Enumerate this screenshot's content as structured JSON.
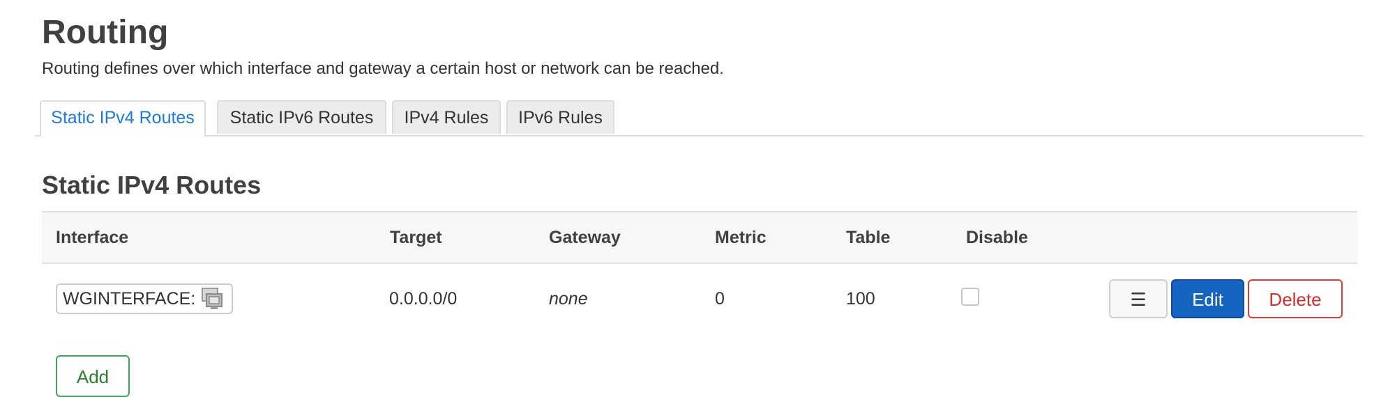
{
  "page": {
    "title": "Routing",
    "description": "Routing defines over which interface and gateway a certain host or network can be reached."
  },
  "tabs": [
    {
      "label": "Static IPv4 Routes",
      "active": true
    },
    {
      "label": "Static IPv6 Routes",
      "active": false
    },
    {
      "label": "IPv4 Rules",
      "active": false
    },
    {
      "label": "IPv6 Rules",
      "active": false
    }
  ],
  "section": {
    "title": "Static IPv4 Routes",
    "columns": [
      "Interface",
      "Target",
      "Gateway",
      "Metric",
      "Table",
      "Disable"
    ],
    "rows": [
      {
        "interface": "WGINTERFACE:",
        "interface_icon": "network-interface-icon",
        "target": "0.0.0.0/0",
        "gateway": "none",
        "metric": "0",
        "table": "100",
        "disabled": false
      }
    ],
    "buttons": {
      "menu": "☰",
      "edit": "Edit",
      "delete": "Delete",
      "add": "Add"
    }
  },
  "colors": {
    "active_tab": "#1f7ad0",
    "edit_button": "#1565c0",
    "delete_border": "#e53935",
    "add_border": "#3fa35f"
  }
}
